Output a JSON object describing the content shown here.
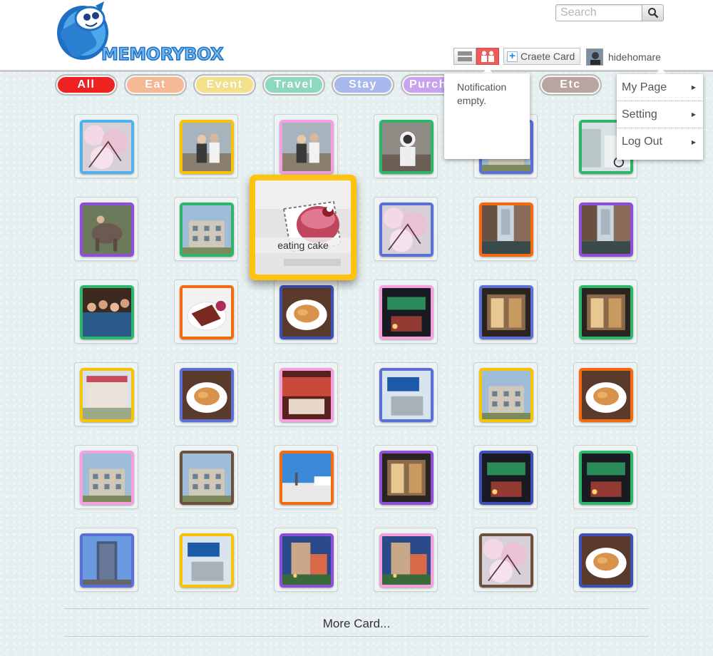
{
  "app": {
    "logo_text": "MEMORYBOX"
  },
  "header": {
    "search_placeholder": "Search",
    "create_card_label": "Craete Card",
    "username": "hidehomare"
  },
  "categories": [
    {
      "label": "All",
      "color": "#ef2222",
      "active": true
    },
    {
      "label": "Eat",
      "color": "#f4b893"
    },
    {
      "label": "Event",
      "color": "#f5e08a"
    },
    {
      "label": "Travel",
      "color": "#8fd8c0"
    },
    {
      "label": "Stay",
      "color": "#a9b9ee"
    },
    {
      "label": "Purchase",
      "color": "#c8a4f0"
    },
    {
      "label": "Etc",
      "color": "#b9a49f"
    }
  ],
  "notification": {
    "text": "Notification empty."
  },
  "user_menu": {
    "items": [
      "My Page",
      "Setting",
      "Log Out"
    ]
  },
  "hover_card": {
    "caption": "eating cake",
    "frame_color": "#ffc20e"
  },
  "cards": [
    {
      "frame": "#4fb2ec",
      "scene": "blossom"
    },
    {
      "frame": "#f6c400",
      "scene": "people"
    },
    {
      "frame": "#f4a0dc",
      "scene": "people"
    },
    {
      "frame": "#2fb56a",
      "scene": "astronaut"
    },
    {
      "frame": "#5b6fd6",
      "scene": "building"
    },
    {
      "frame": "#2fb56a",
      "scene": "street"
    },
    {
      "frame": "#8c4fd6",
      "scene": "elephant"
    },
    {
      "frame": "#2fb56a",
      "scene": "building"
    },
    {
      "frame": "#f6c400",
      "scene": "cake"
    },
    {
      "frame": "#5b6fd6",
      "scene": "blossom"
    },
    {
      "frame": "#f46a10",
      "scene": "canal"
    },
    {
      "frame": "#8c4fd6",
      "scene": "canal"
    },
    {
      "frame": "#2fb56a",
      "scene": "crowd"
    },
    {
      "frame": "#f46a10",
      "scene": "steak"
    },
    {
      "frame": "#3e4fb6",
      "scene": "food"
    },
    {
      "frame": "#f4a0dc",
      "scene": "night"
    },
    {
      "frame": "#5b6fd6",
      "scene": "interior"
    },
    {
      "frame": "#2fb56a",
      "scene": "interior"
    },
    {
      "frame": "#f6c400",
      "scene": "shop"
    },
    {
      "frame": "#5b6fd6",
      "scene": "food"
    },
    {
      "frame": "#f4a0dc",
      "scene": "restaurant"
    },
    {
      "frame": "#5b6fd6",
      "scene": "sign"
    },
    {
      "frame": "#f6c400",
      "scene": "building"
    },
    {
      "frame": "#f46a10",
      "scene": "food"
    },
    {
      "frame": "#f4a0dc",
      "scene": "building"
    },
    {
      "frame": "#6b4f3f",
      "scene": "building"
    },
    {
      "frame": "#f46a10",
      "scene": "sky"
    },
    {
      "frame": "#8c4fd6",
      "scene": "interior"
    },
    {
      "frame": "#3e4fb6",
      "scene": "night"
    },
    {
      "frame": "#2fb56a",
      "scene": "night"
    },
    {
      "frame": "#5b6fd6",
      "scene": "tower"
    },
    {
      "frame": "#f6c400",
      "scene": "sign"
    },
    {
      "frame": "#8c4fd6",
      "scene": "hotel"
    },
    {
      "frame": "#f4a0dc",
      "scene": "hotel"
    },
    {
      "frame": "#6b4f3f",
      "scene": "blossom"
    },
    {
      "frame": "#3e4fb6",
      "scene": "food"
    }
  ],
  "more_label": "More Card..."
}
